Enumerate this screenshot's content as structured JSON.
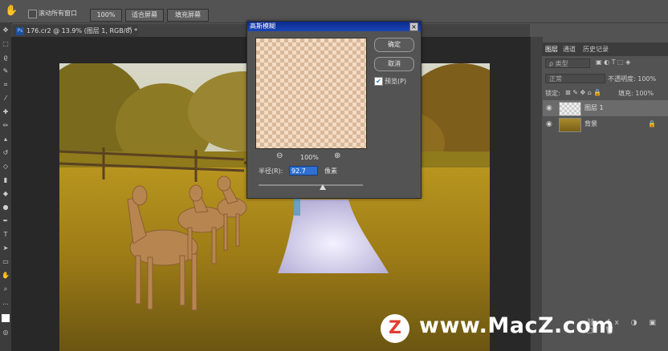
{
  "options_bar": {
    "scroll_all_label": "滚动所有窗口",
    "zoom_100": "100%",
    "fit_screen": "适合屏幕",
    "fill_screen": "填充屏幕"
  },
  "document": {
    "tab_title": "176.cr2 @ 13.9% (图层 1, RGB/8) *"
  },
  "panel": {
    "tabs": [
      "图层",
      "通道",
      "历史记录"
    ],
    "kind_label": "ρ 类型",
    "blend_mode": "正常",
    "opacity_label": "不透明度: 100%",
    "lock_label": "锁定:",
    "fill_label": "填充: 100%",
    "layers": [
      {
        "name": "图层 1"
      },
      {
        "name": "背景"
      }
    ]
  },
  "dialog": {
    "title": "高斯模糊",
    "ok": "确定",
    "cancel": "取消",
    "preview_label": "预览(P)",
    "preview_checked": true,
    "zoom_level": "100%",
    "radius_label": "半径(R):",
    "radius_value": "92.7",
    "unit": "像素"
  },
  "watermark": {
    "logo": "Z",
    "text": "www.MacZ.com"
  }
}
